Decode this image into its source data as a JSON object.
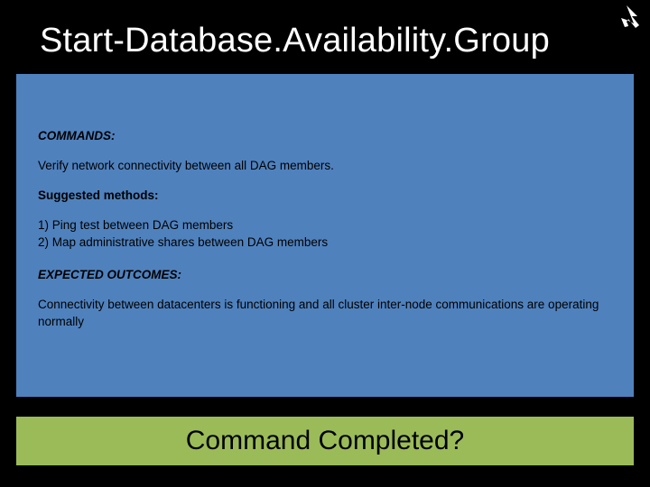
{
  "title": "Start-Database.Availability.Group",
  "content": {
    "commands_heading": "COMMANDS:",
    "verify_line": "Verify network connectivity between all DAG members.",
    "methods_label": "Suggested methods:",
    "method1": "1) Ping test between DAG members",
    "method2": "2) Map administrative shares between DAG members",
    "outcomes_heading": "EXPECTED OUTCOMES:",
    "outcome_text": "Connectivity between datacenters is functioning and all cluster inter-node communications are operating normally"
  },
  "footer": {
    "label": "Command Completed?"
  }
}
